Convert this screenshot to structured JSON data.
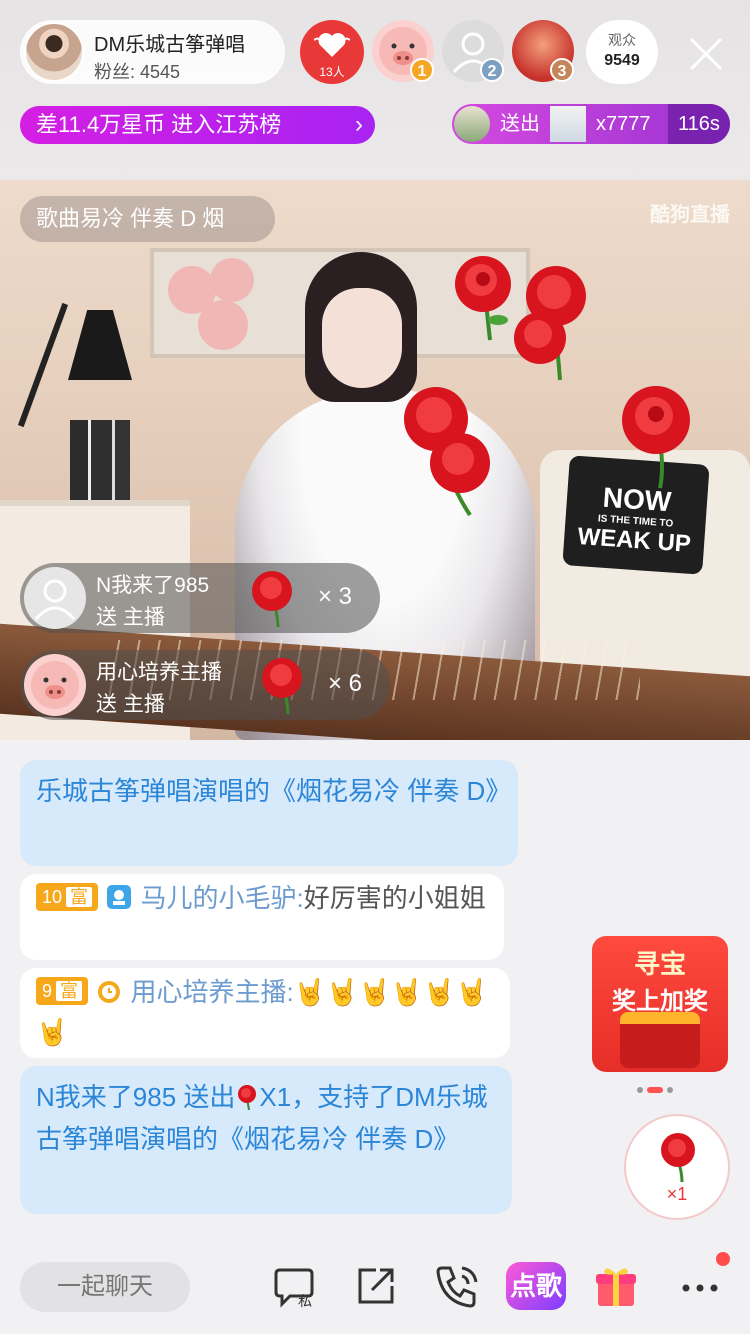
{
  "header": {
    "host_name": "DM乐城古筝弹唱",
    "fans_label": "粉丝: 4545",
    "guard_count": "13人",
    "top_ranks": [
      "1",
      "2",
      "3"
    ],
    "viewers_label": "观众",
    "viewers_count": "9549",
    "close_icon": "close-icon"
  },
  "rank_banner": {
    "text": "差11.4万星币 进入江苏榜",
    "arrow": "›"
  },
  "gift_banner": {
    "action": "送出",
    "count": "x7777",
    "timer": "116s"
  },
  "video": {
    "song_label": "歌曲易冷 伴奏 D    烟",
    "watermark": "酷狗直播",
    "pillow_line1": "NOW",
    "pillow_line2": "IS THE TIME TO",
    "pillow_line3": "WEAK UP"
  },
  "gift_notifications": [
    {
      "name": "N我来了985",
      "action": "送 主播",
      "multiplier": "× 3"
    },
    {
      "name": "用心培养主播",
      "action": "送 主播",
      "multiplier": "× 6"
    }
  ],
  "chat": [
    {
      "type": "system",
      "text": "乐城古筝弹唱演唱的《烟花易冷 伴奏 D》"
    },
    {
      "type": "user",
      "level": "10",
      "level_tag": "富",
      "user": "马儿的小毛驴:",
      "message": "好厉害的小姐姐"
    },
    {
      "type": "user",
      "level": "9",
      "level_tag": "富",
      "user": "用心培养主播:",
      "message": "🤘🤘🤘🤘🤘🤘🤘"
    },
    {
      "type": "system",
      "text_part1": "N我来了985 送出",
      "text_part2": "X1，支持了DM乐城古筝弹唱演唱的《烟花易冷 伴奏 D》"
    }
  ],
  "treasure": {
    "line1": "寻宝",
    "line2": "奖上加奖"
  },
  "quick_gift": {
    "multiplier": "×1"
  },
  "bottom_bar": {
    "chat_placeholder": "一起聊天",
    "dian_label": "点歌"
  },
  "colors": {
    "accent_red": "#e83838",
    "rank_purple": "#a823f2",
    "system_text": "#2c86d8",
    "level_orange": "#f7a81a"
  }
}
